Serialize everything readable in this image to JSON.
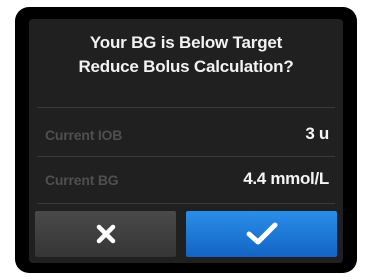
{
  "dialog": {
    "title_line1": "Your BG is Below Target",
    "title_line2": "Reduce Bolus Calculation?"
  },
  "rows": [
    {
      "label": "Current IOB",
      "value": "3 u"
    },
    {
      "label": "Current BG",
      "value": "4.4 mmol/L"
    }
  ],
  "buttons": {
    "cancel_icon": "close-icon",
    "confirm_icon": "checkmark-icon"
  },
  "colors": {
    "screen_bg": "#202020",
    "confirm_blue": "#1f7ad8",
    "cancel_gray": "#404040",
    "label_gray": "#4f4f4f"
  }
}
